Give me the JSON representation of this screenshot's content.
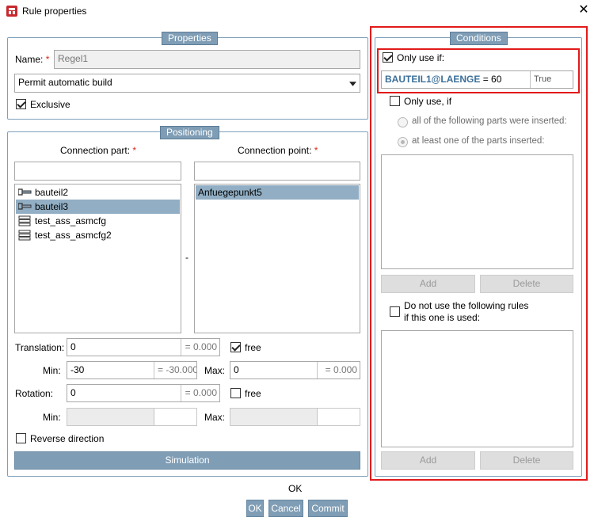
{
  "window": {
    "title": "Rule properties",
    "close": "✕"
  },
  "properties": {
    "group_title": "Properties",
    "name_label": "Name:",
    "required_mark": "*",
    "name_value": "Regel1",
    "build_select": "Permit automatic build",
    "exclusive_label": "Exclusive",
    "exclusive_checked": true
  },
  "positioning": {
    "group_title": "Positioning",
    "connection_part_label": "Connection part:",
    "connection_point_label": "Connection point:",
    "parts": [
      {
        "label": "bauteil2",
        "icon": "part-icon",
        "selected": false
      },
      {
        "label": "bauteil3",
        "icon": "part-icon",
        "selected": true
      },
      {
        "label": "test_ass_asmcfg",
        "icon": "assembly-icon",
        "selected": false
      },
      {
        "label": "test_ass_asmcfg2",
        "icon": "assembly-icon",
        "selected": false
      }
    ],
    "points": [
      {
        "label": "Anfuegepunkt5",
        "selected": true
      }
    ],
    "separator": "-",
    "translation_label": "Translation:",
    "translation_value": "0",
    "translation_result": "= 0.000",
    "translation_free_label": "free",
    "translation_free_checked": true,
    "min_label": "Min:",
    "max_label": "Max:",
    "t_min_value": "-30",
    "t_min_result": "= -30.000",
    "t_max_value": "0",
    "t_max_result": "= 0.000",
    "rotation_label": "Rotation:",
    "rotation_value": "0",
    "rotation_result": "= 0.000",
    "rotation_free_label": "free",
    "rotation_free_checked": false,
    "reverse_label": "Reverse direction",
    "simulation_label": "Simulation"
  },
  "conditions": {
    "group_title": "Conditions",
    "only_use_if_label": "Only use if:",
    "only_use_if_checked": true,
    "expr_variable": "BAUTEIL1@LAENGE",
    "expr_rest": " = 60",
    "expr_result": "True",
    "only_use_if2_label": "Only use, if",
    "radio_all_label": "all of the following parts were inserted:",
    "radio_one_label": "at least one of the parts inserted:",
    "add_label": "Add",
    "delete_label": "Delete",
    "do_not_use_label_line1": "Do not use the following rules",
    "do_not_use_label_line2": "if this one is used:"
  },
  "footer": {
    "status": "OK",
    "ok_label": "OK",
    "cancel_label": "Cancel",
    "commit_label": "Commit"
  },
  "colors": {
    "accent": "#7f9db5",
    "selection": "#91aec4",
    "highlight_frame": "#e21a1a",
    "expression_text": "#3b6f99"
  }
}
